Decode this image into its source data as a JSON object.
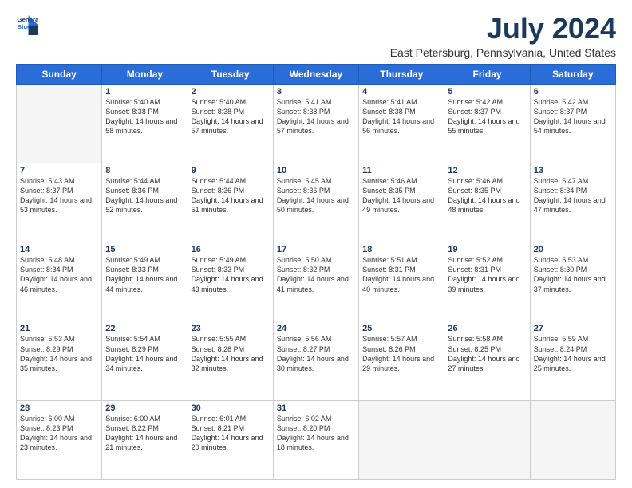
{
  "logo": {
    "line1": "General",
    "line2": "Blue"
  },
  "title": "July 2024",
  "subtitle": "East Petersburg, Pennsylvania, United States",
  "days_header": [
    "Sunday",
    "Monday",
    "Tuesday",
    "Wednesday",
    "Thursday",
    "Friday",
    "Saturday"
  ],
  "weeks": [
    [
      {
        "day": "",
        "empty": true
      },
      {
        "day": "1",
        "sunrise": "5:40 AM",
        "sunset": "8:38 PM",
        "daylight": "14 hours and 58 minutes."
      },
      {
        "day": "2",
        "sunrise": "5:40 AM",
        "sunset": "8:38 PM",
        "daylight": "14 hours and 57 minutes."
      },
      {
        "day": "3",
        "sunrise": "5:41 AM",
        "sunset": "8:38 PM",
        "daylight": "14 hours and 57 minutes."
      },
      {
        "day": "4",
        "sunrise": "5:41 AM",
        "sunset": "8:38 PM",
        "daylight": "14 hours and 56 minutes."
      },
      {
        "day": "5",
        "sunrise": "5:42 AM",
        "sunset": "8:37 PM",
        "daylight": "14 hours and 55 minutes."
      },
      {
        "day": "6",
        "sunrise": "5:42 AM",
        "sunset": "8:37 PM",
        "daylight": "14 hours and 54 minutes."
      }
    ],
    [
      {
        "day": "7",
        "sunrise": "5:43 AM",
        "sunset": "8:37 PM",
        "daylight": "14 hours and 53 minutes."
      },
      {
        "day": "8",
        "sunrise": "5:44 AM",
        "sunset": "8:36 PM",
        "daylight": "14 hours and 52 minutes."
      },
      {
        "day": "9",
        "sunrise": "5:44 AM",
        "sunset": "8:36 PM",
        "daylight": "14 hours and 51 minutes."
      },
      {
        "day": "10",
        "sunrise": "5:45 AM",
        "sunset": "8:36 PM",
        "daylight": "14 hours and 50 minutes."
      },
      {
        "day": "11",
        "sunrise": "5:46 AM",
        "sunset": "8:35 PM",
        "daylight": "14 hours and 49 minutes."
      },
      {
        "day": "12",
        "sunrise": "5:46 AM",
        "sunset": "8:35 PM",
        "daylight": "14 hours and 48 minutes."
      },
      {
        "day": "13",
        "sunrise": "5:47 AM",
        "sunset": "8:34 PM",
        "daylight": "14 hours and 47 minutes."
      }
    ],
    [
      {
        "day": "14",
        "sunrise": "5:48 AM",
        "sunset": "8:34 PM",
        "daylight": "14 hours and 46 minutes."
      },
      {
        "day": "15",
        "sunrise": "5:49 AM",
        "sunset": "8:33 PM",
        "daylight": "14 hours and 44 minutes."
      },
      {
        "day": "16",
        "sunrise": "5:49 AM",
        "sunset": "8:33 PM",
        "daylight": "14 hours and 43 minutes."
      },
      {
        "day": "17",
        "sunrise": "5:50 AM",
        "sunset": "8:32 PM",
        "daylight": "14 hours and 41 minutes."
      },
      {
        "day": "18",
        "sunrise": "5:51 AM",
        "sunset": "8:31 PM",
        "daylight": "14 hours and 40 minutes."
      },
      {
        "day": "19",
        "sunrise": "5:52 AM",
        "sunset": "8:31 PM",
        "daylight": "14 hours and 39 minutes."
      },
      {
        "day": "20",
        "sunrise": "5:53 AM",
        "sunset": "8:30 PM",
        "daylight": "14 hours and 37 minutes."
      }
    ],
    [
      {
        "day": "21",
        "sunrise": "5:53 AM",
        "sunset": "8:29 PM",
        "daylight": "14 hours and 35 minutes."
      },
      {
        "day": "22",
        "sunrise": "5:54 AM",
        "sunset": "8:29 PM",
        "daylight": "14 hours and 34 minutes."
      },
      {
        "day": "23",
        "sunrise": "5:55 AM",
        "sunset": "8:28 PM",
        "daylight": "14 hours and 32 minutes."
      },
      {
        "day": "24",
        "sunrise": "5:56 AM",
        "sunset": "8:27 PM",
        "daylight": "14 hours and 30 minutes."
      },
      {
        "day": "25",
        "sunrise": "5:57 AM",
        "sunset": "8:26 PM",
        "daylight": "14 hours and 29 minutes."
      },
      {
        "day": "26",
        "sunrise": "5:58 AM",
        "sunset": "8:25 PM",
        "daylight": "14 hours and 27 minutes."
      },
      {
        "day": "27",
        "sunrise": "5:59 AM",
        "sunset": "8:24 PM",
        "daylight": "14 hours and 25 minutes."
      }
    ],
    [
      {
        "day": "28",
        "sunrise": "6:00 AM",
        "sunset": "8:23 PM",
        "daylight": "14 hours and 23 minutes."
      },
      {
        "day": "29",
        "sunrise": "6:00 AM",
        "sunset": "8:22 PM",
        "daylight": "14 hours and 21 minutes."
      },
      {
        "day": "30",
        "sunrise": "6:01 AM",
        "sunset": "8:21 PM",
        "daylight": "14 hours and 20 minutes."
      },
      {
        "day": "31",
        "sunrise": "6:02 AM",
        "sunset": "8:20 PM",
        "daylight": "14 hours and 18 minutes."
      },
      {
        "day": "",
        "empty": true
      },
      {
        "day": "",
        "empty": true
      },
      {
        "day": "",
        "empty": true
      }
    ]
  ]
}
